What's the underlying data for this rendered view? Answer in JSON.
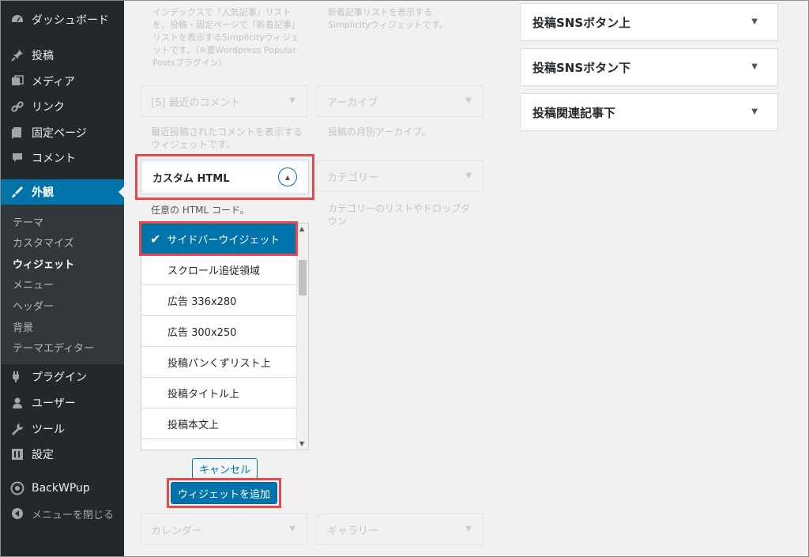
{
  "sidebar": {
    "menu": [
      {
        "label": "ダッシュボード",
        "icon": "dashboard-icon"
      },
      {
        "label": "投稿",
        "icon": "pin-icon"
      },
      {
        "label": "メディア",
        "icon": "media-icon"
      },
      {
        "label": "リンク",
        "icon": "link-icon"
      },
      {
        "label": "固定ページ",
        "icon": "page-icon"
      },
      {
        "label": "コメント",
        "icon": "comment-icon"
      },
      {
        "label": "外観",
        "icon": "appearance-icon"
      }
    ],
    "submenu": [
      {
        "label": "テーマ"
      },
      {
        "label": "カスタマイズ"
      },
      {
        "label": "ウィジェット"
      },
      {
        "label": "メニュー"
      },
      {
        "label": "ヘッダー"
      },
      {
        "label": "背景"
      },
      {
        "label": "テーマエディター"
      }
    ],
    "menu2": [
      {
        "label": "プラグイン",
        "icon": "plugin-icon"
      },
      {
        "label": "ユーザー",
        "icon": "user-icon"
      },
      {
        "label": "ツール",
        "icon": "wrench-icon"
      },
      {
        "label": "設定",
        "icon": "settings-icon"
      },
      {
        "label": "BackWPup",
        "icon": "backwpup-icon"
      },
      {
        "label": "メニューを閉じる",
        "icon": "collapse-icon"
      }
    ]
  },
  "available": {
    "popular_desc": "インデックスで「人気記事」リストを、投稿・固定ページで「新着記事」リストを表示するSimplicityウィジェットです。（※要Wordpress Popular Postsプラグイン）",
    "new_desc": "新着記事リストを表示するSimplicityウィジェットです。",
    "recent_comments": {
      "title": "[S] 最近のコメント",
      "desc": "最近投稿されたコメントを表示するウィジェットです。"
    },
    "archive": {
      "title": "アーカイブ",
      "desc": "投稿の月別アーカイブ。"
    },
    "custom_html": {
      "title": "カスタム HTML",
      "desc": "任意の HTML コード。"
    },
    "category": {
      "title": "カテゴリー",
      "desc": "カテゴリーのリストやドロップダウン"
    },
    "calendar": {
      "title": "カレンダー"
    },
    "gallery": {
      "title": "ギャラリー"
    }
  },
  "chooser": {
    "options": [
      "サイドバーウイジェット",
      "スクロール追従領域",
      "広告 336x280",
      "広告 300x250",
      "投稿パンくずリスト上",
      "投稿タイトル上",
      "投稿本文上"
    ],
    "cancel_label": "キャンセル",
    "add_label": "ウィジェットを追加"
  },
  "widget_areas": [
    {
      "title": "投稿SNSボタン上"
    },
    {
      "title": "投稿SNSボタン下"
    },
    {
      "title": "投稿関連記事下"
    }
  ],
  "colors": {
    "sidebar_bg": "#23282d",
    "accent": "#0073aa",
    "highlight": "#e8474c"
  }
}
